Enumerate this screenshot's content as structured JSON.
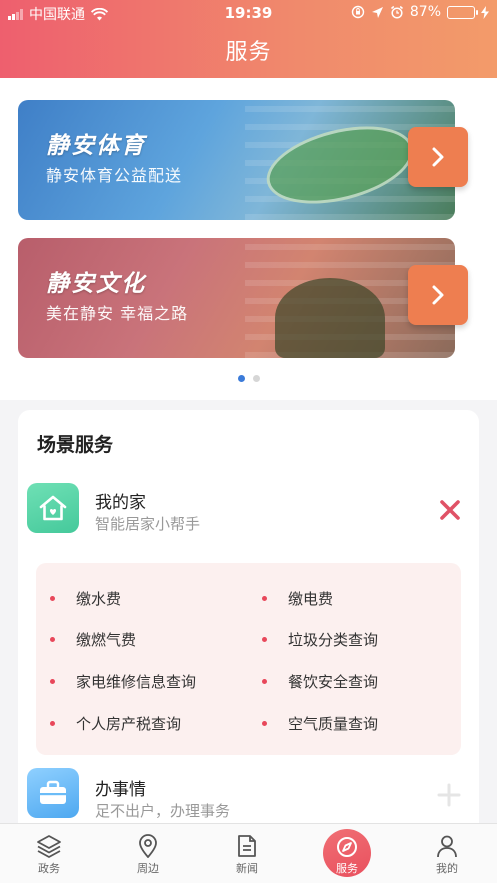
{
  "status_bar": {
    "carrier": "中国联通",
    "time": "19:39",
    "battery_percent": "87%",
    "battery_level": 0.87
  },
  "header": {
    "title": "服务"
  },
  "banners": [
    {
      "title": "静安体育",
      "subtitle": "静安体育公益配送"
    },
    {
      "title": "静安文化",
      "subtitle": "美在静安 幸福之路"
    }
  ],
  "carousel": {
    "count": 2,
    "active_index": 0
  },
  "scene_services": {
    "heading": "场景服务",
    "items": [
      {
        "name": "我的家",
        "subtitle": "智能居家小帮手",
        "icon": "home-icon",
        "expanded": true,
        "sub_items": [
          "缴水费",
          "缴电费",
          "缴燃气费",
          "垃圾分类查询",
          "家电维修信息查询",
          "餐饮安全查询",
          "个人房产税查询",
          "空气质量查询"
        ]
      },
      {
        "name": "办事情",
        "subtitle": "足不出户，办理事务",
        "icon": "briefcase-icon",
        "expanded": false
      }
    ]
  },
  "tab_bar": {
    "items": [
      {
        "label": "政务",
        "icon": "layers-icon"
      },
      {
        "label": "周边",
        "icon": "location-pin-icon"
      },
      {
        "label": "新闻",
        "icon": "document-icon"
      },
      {
        "label": "服务",
        "icon": "compass-icon",
        "active": true
      },
      {
        "label": "我的",
        "icon": "user-icon"
      }
    ]
  },
  "colors": {
    "header_gradient_start": "#ee5f6e",
    "header_gradient_end": "#f39b6a",
    "accent_red": "#e8475a",
    "arrow_button": "#ee7e50",
    "carousel_active_dot": "#3b7bd9"
  }
}
